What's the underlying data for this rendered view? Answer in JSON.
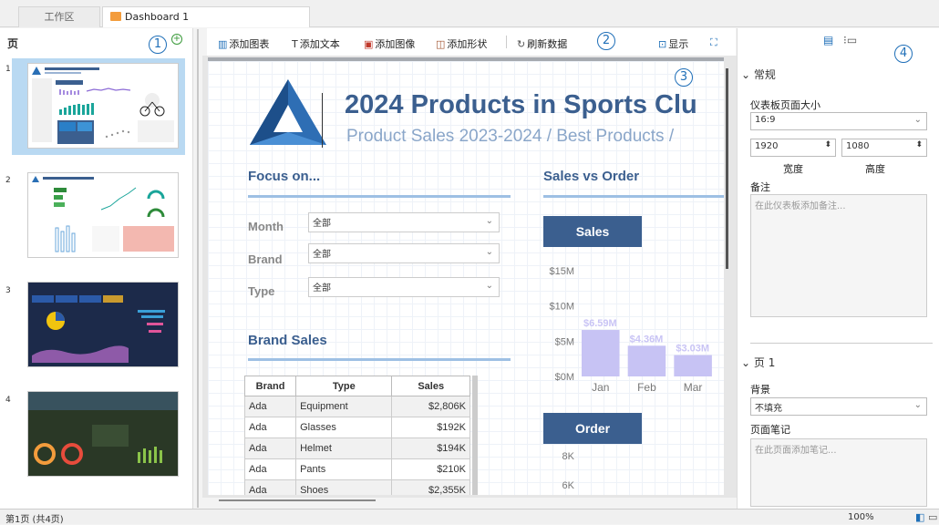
{
  "tabs": {
    "workspace": "工作区",
    "dashboard": "Dashboard 1"
  },
  "left_panel": {
    "title": "页",
    "callout": "1",
    "add_icon": "plus-circle-icon",
    "thumbnails": [
      {
        "num": "1",
        "selected": true
      },
      {
        "num": "2",
        "selected": false
      },
      {
        "num": "3",
        "selected": false
      },
      {
        "num": "4",
        "selected": false
      }
    ]
  },
  "toolbar": {
    "add_chart": "添加图表",
    "add_text": "添加文本",
    "add_image": "添加图像",
    "add_shape": "添加形状",
    "refresh": "刷新数据",
    "callout": "2",
    "display": "显示"
  },
  "dashboard": {
    "callout": "3",
    "title": "2024 Products in Sports Clu",
    "subtitle": "Product Sales 2023-2024 / Best Products /",
    "focus": {
      "title": "Focus on...",
      "filters": [
        {
          "label": "Month",
          "value": "全部"
        },
        {
          "label": "Brand",
          "value": "全部"
        },
        {
          "label": "Type",
          "value": "全部"
        }
      ]
    },
    "brand_sales": {
      "title": "Brand Sales",
      "columns": [
        "Brand",
        "Type",
        "Sales"
      ],
      "rows": [
        [
          "Ada",
          "Equipment",
          "$2,806K"
        ],
        [
          "Ada",
          "Glasses",
          "$192K"
        ],
        [
          "Ada",
          "Helmet",
          "$194K"
        ],
        [
          "Ada",
          "Pants",
          "$210K"
        ],
        [
          "Ada",
          "Shoes",
          "$2,355K"
        ]
      ]
    },
    "sales_vs_order": {
      "title": "Sales vs Order",
      "sales_header": "Sales",
      "order_header": "Order"
    }
  },
  "chart_data": [
    {
      "type": "bar",
      "title": "Sales",
      "categories": [
        "Jan",
        "Feb",
        "Mar"
      ],
      "values": [
        6.59,
        4.36,
        3.03
      ],
      "data_labels": [
        "$6.59M",
        "$4.36M",
        "$3.03M"
      ],
      "ytick_labels": [
        "$0M",
        "$5M",
        "$10M",
        "$15M"
      ],
      "ylim": [
        0,
        15
      ],
      "color": "#c7c3f4"
    },
    {
      "type": "bar",
      "title": "Order",
      "ytick_labels": [
        "8K",
        "6K"
      ]
    }
  ],
  "right_panel": {
    "callout": "4",
    "general_title": "常规",
    "page_size_label": "仪表板页面大小",
    "page_size_value": "16:9",
    "width_value": "1920",
    "height_value": "1080",
    "width_label": "宽度",
    "height_label": "高度",
    "note_label": "备注",
    "note_placeholder": "在此仪表板添加备注...",
    "page_title": "页 1",
    "bg_label": "背景",
    "bg_value": "不填充",
    "page_note_label": "页面笔记",
    "page_note_placeholder": "在此页面添加笔记..."
  },
  "status": {
    "page_info": "第1页 (共4页)",
    "zoom": "100%"
  },
  "colors": {
    "accent": "#3b5f8f",
    "light_accent": "#8aa6c9",
    "selection": "#b9d9f2",
    "callout": "#1f6fb8"
  }
}
